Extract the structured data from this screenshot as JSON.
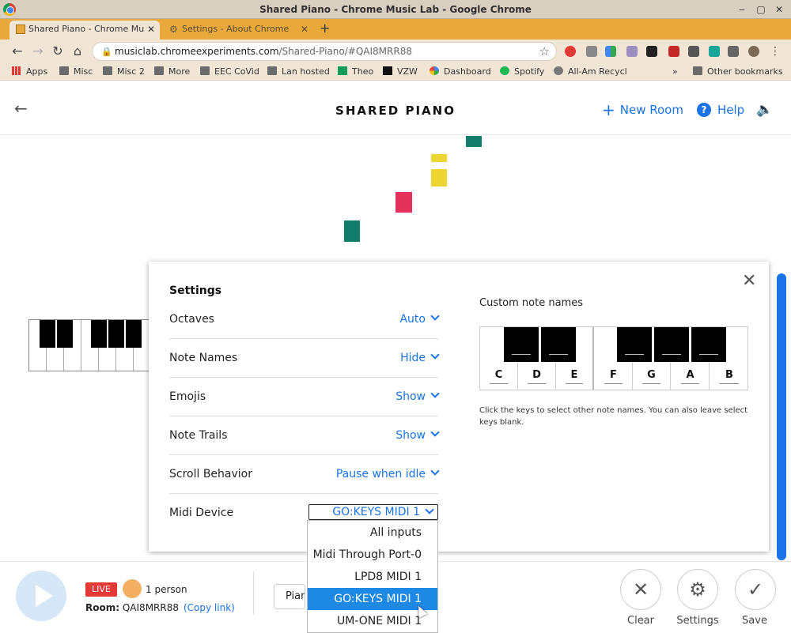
{
  "window": {
    "title": "Shared Piano - Chrome Music Lab - Google Chrome"
  },
  "tabs": [
    {
      "label": "Shared Piano - Chrome Mu",
      "active": true
    },
    {
      "label": "Settings - About Chrome",
      "active": false
    }
  ],
  "toolbar": {
    "url_host": "musiclab.chromeexperiments.com",
    "url_path": "/Shared-Piano/#QAI8MRR88"
  },
  "bookmarks": [
    {
      "label": "Apps",
      "icon": "apps-grid-icon"
    },
    {
      "label": "Misc",
      "icon": "folder-icon"
    },
    {
      "label": "Misc 2",
      "icon": "folder-icon"
    },
    {
      "label": "More",
      "icon": "folder-icon"
    },
    {
      "label": "EEC CoVid",
      "icon": "folder-icon"
    },
    {
      "label": "Lan hosted",
      "icon": "folder-icon"
    },
    {
      "label": "Theo",
      "icon": "green-plus-icon"
    },
    {
      "label": "VZW",
      "icon": "vzw-check-icon"
    },
    {
      "label": "Dashboard",
      "icon": "google-icon"
    },
    {
      "label": "Spotify",
      "icon": "spotify-icon"
    },
    {
      "label": "All-Am Recycl",
      "icon": "globe-icon"
    },
    {
      "label": "Other bookmarks",
      "icon": "folder-icon"
    }
  ],
  "header": {
    "brand": "SHARED PIANO",
    "new_room": "New Room",
    "help": "Help"
  },
  "colors": {
    "accent": "#1a73e8",
    "teal": "#127d6a",
    "yellow": "#eed632",
    "red": "#e2325a",
    "live": "#e53935",
    "selected": "#1e88e5"
  },
  "settings": {
    "title": "Settings",
    "rows": [
      {
        "label": "Octaves",
        "value": "Auto"
      },
      {
        "label": "Note Names",
        "value": "Hide"
      },
      {
        "label": "Emojis",
        "value": "Show"
      },
      {
        "label": "Note Trails",
        "value": "Show"
      },
      {
        "label": "Scroll Behavior",
        "value": "Pause when idle"
      },
      {
        "label": "Midi Device",
        "value": "GO:KEYS MIDI 1"
      }
    ],
    "custom_title": "Custom note names",
    "custom_keys": [
      "C",
      "D",
      "E",
      "F",
      "G",
      "A",
      "B"
    ],
    "custom_help": "Click the keys to select other note names. You can also leave select keys blank.",
    "midi_options": [
      "All inputs",
      "Midi Through Port-0",
      "LPD8 MIDI 1",
      "GO:KEYS MIDI 1",
      "UM-ONE MIDI 1"
    ],
    "midi_selected_index": 3
  },
  "footer": {
    "live": "LIVE",
    "people": "1 person",
    "room_label": "Room:",
    "room_code": "QAI8MRR88",
    "copy_link": "(Copy link)",
    "instrument": "Piano",
    "clear": "Clear",
    "settings": "Settings",
    "save": "Save"
  }
}
